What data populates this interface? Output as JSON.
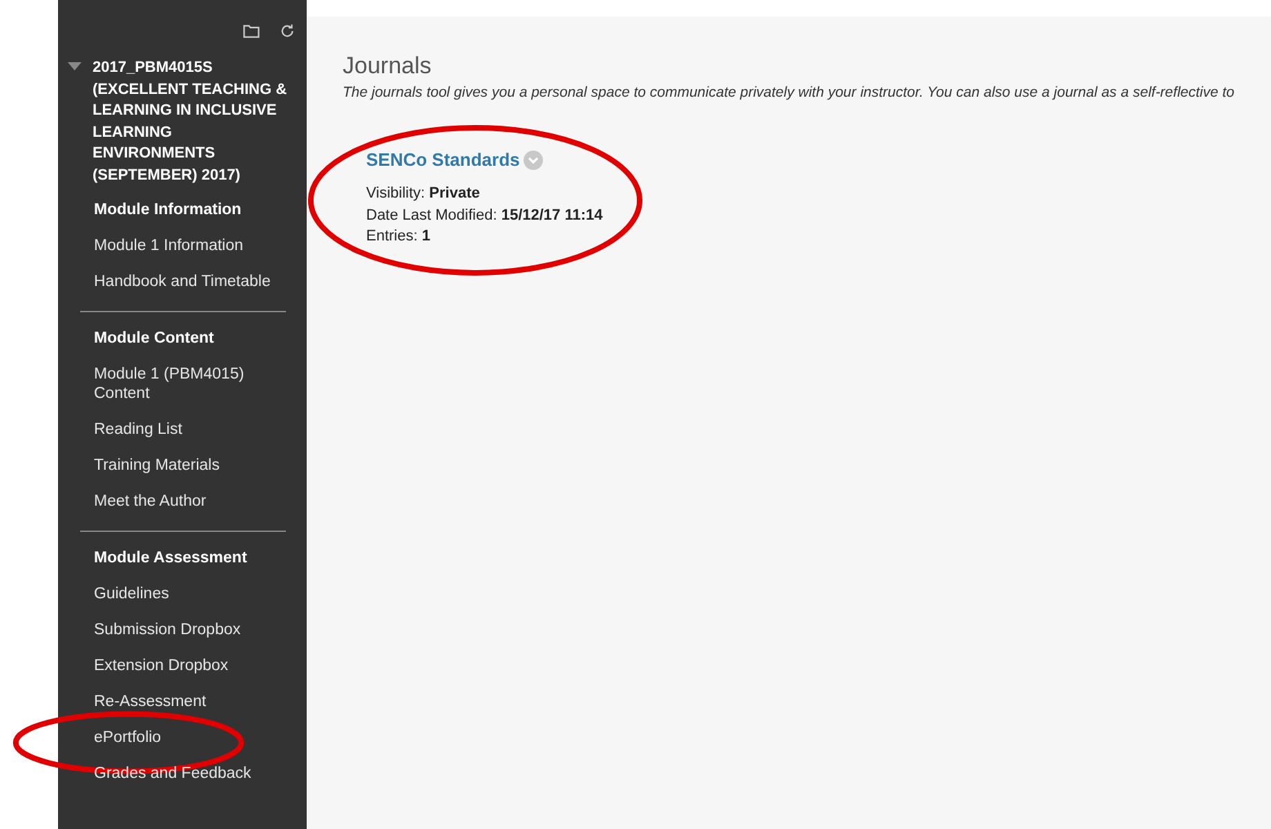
{
  "sidebar": {
    "course_title": "2017_PBM4015S (EXCELLENT TEACHING & LEARNING IN INCLUSIVE LEARNING ENVIRONMENTS (SEPTEMBER) 2017)",
    "expanded": true,
    "sections": [
      {
        "heading": "Module Information",
        "items": [
          {
            "label": "Module 1 Information",
            "circled": false
          },
          {
            "label": "Handbook and Timetable",
            "circled": false
          }
        ]
      },
      {
        "heading": "Module Content",
        "items": [
          {
            "label": "Module 1 (PBM4015) Content",
            "circled": false
          },
          {
            "label": "Reading List",
            "circled": false
          },
          {
            "label": "Training Materials",
            "circled": false
          },
          {
            "label": "Meet the Author",
            "circled": false
          }
        ]
      },
      {
        "heading": "Module Assessment",
        "items": [
          {
            "label": "Guidelines",
            "circled": false
          },
          {
            "label": "Submission Dropbox",
            "circled": false
          },
          {
            "label": "Extension Dropbox",
            "circled": false
          },
          {
            "label": "Re-Assessment",
            "circled": false
          },
          {
            "label": "ePortfolio",
            "circled": true
          },
          {
            "label": "Grades and Feedback",
            "circled": false
          }
        ]
      }
    ]
  },
  "page": {
    "title": "Journals",
    "description": "The journals tool gives you a personal space to communicate privately with your instructor. You can also use a journal as a self-reflective to",
    "journals": [
      {
        "title": "SENCo Standards",
        "circled": true,
        "details": [
          {
            "label": "Visibility:",
            "value": "Private"
          },
          {
            "label": "Date Last Modified:",
            "value": "15/12/17 11:14"
          },
          {
            "label": "Entries:",
            "value": "1"
          }
        ]
      }
    ]
  }
}
